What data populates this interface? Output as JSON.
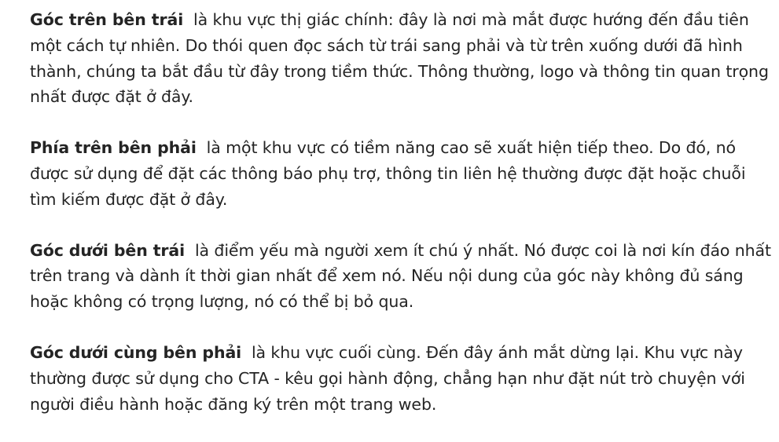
{
  "article": {
    "paragraphs": [
      {
        "term": "Góc trên bên trái",
        "body": "là khu vực thị giác chính: đây là nơi mà mắt được hướng đến đầu tiên một cách tự nhiên. Do thói quen đọc sách từ trái sang phải và từ trên xuống dưới đã hình thành, chúng ta bắt đầu từ đây trong tiềm thức. Thông thường, logo và thông tin quan trọng nhất được đặt ở đây."
      },
      {
        "term": "Phía trên bên phải",
        "body": "là một khu vực có tiềm năng cao sẽ xuất hiện tiếp theo. Do đó, nó được sử dụng để đặt các thông báo phụ trợ, thông tin liên hệ thường được đặt hoặc chuỗi tìm kiếm được đặt ở đây."
      },
      {
        "term": "Góc dưới bên trái",
        "body": "là điểm yếu mà người xem ít chú ý nhất. Nó được coi là nơi kín đáo nhất trên trang và dành ít thời gian nhất để xem nó. Nếu nội dung của góc này không đủ sáng hoặc không có trọng lượng, nó có thể bị bỏ qua."
      },
      {
        "term": "Góc dưới cùng bên phải",
        "body": "là khu vực cuối cùng. Đến đây ánh mắt dừng lại. Khu vực này thường được sử dụng cho CTA - kêu gọi hành động, chẳng hạn như đặt nút trò chuyện với người điều hành hoặc đăng ký trên một trang web."
      }
    ]
  }
}
